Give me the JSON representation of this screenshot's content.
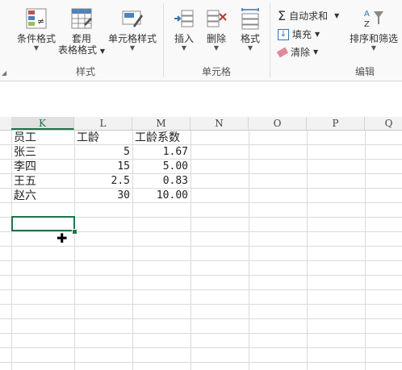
{
  "ribbon": {
    "styles_group": {
      "label": "样式",
      "conditional_format": "条件格式",
      "format_as_table_line1": "套用",
      "format_as_table_line2": "表格格式",
      "cell_styles": "单元格样式"
    },
    "cells_group": {
      "label": "单元格",
      "insert": "插入",
      "delete": "删除",
      "format": "格式"
    },
    "editing_group": {
      "label": "编辑",
      "autosum": "自动求和",
      "fill": "填充",
      "clear": "清除",
      "sort_filter": "排序和筛选"
    }
  },
  "sheet": {
    "columns": [
      "K",
      "L",
      "M",
      "N",
      "O",
      "P",
      "Q"
    ],
    "selected_column": "K",
    "headers": {
      "k": "员工",
      "l": "工龄",
      "m": "工龄系数"
    },
    "rows": [
      {
        "k": "张三",
        "l": "5",
        "m": "1.67"
      },
      {
        "k": "李四",
        "l": "15",
        "m": "5.00"
      },
      {
        "k": "王五",
        "l": "2.5",
        "m": "0.83"
      },
      {
        "k": "赵六",
        "l": "30",
        "m": "10.00"
      }
    ]
  },
  "colors": {
    "accent": "#217346"
  }
}
